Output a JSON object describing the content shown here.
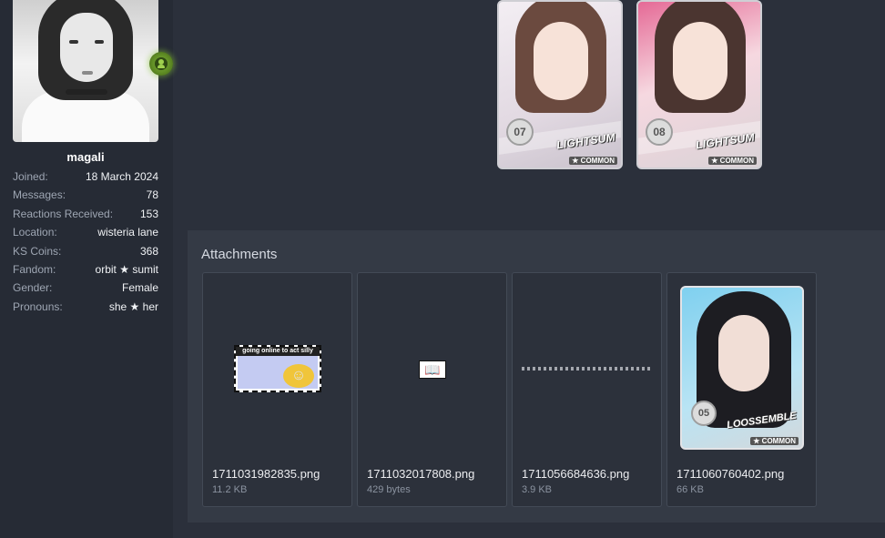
{
  "user": {
    "username": "magali",
    "online_icon": "online-status-icon",
    "stats": [
      {
        "label": "Joined:",
        "value": "18 March 2024"
      },
      {
        "label": "Messages:",
        "value": "78"
      },
      {
        "label": "Reactions Received:",
        "value": "153"
      },
      {
        "label": "Location:",
        "value": "wisteria lane"
      },
      {
        "label": "KS Coins:",
        "value": "368"
      },
      {
        "label": "Fandom:",
        "value": "orbit ★ sumit"
      },
      {
        "label": "Gender:",
        "value": "Female"
      },
      {
        "label": "Pronouns:",
        "value": "she ★ her"
      }
    ]
  },
  "post_cards": [
    {
      "number": "07",
      "group": "LIGHTSUM",
      "rarity": "★ COMMON"
    },
    {
      "number": "08",
      "group": "LIGHTSUM",
      "rarity": "★ COMMON"
    }
  ],
  "attachments": {
    "title": "Attachments",
    "items": [
      {
        "name": "1711031982835.png",
        "size": "11.2 KB",
        "thumb_text": "going online to act silly"
      },
      {
        "name": "1711032017808.png",
        "size": "429 bytes"
      },
      {
        "name": "1711056684636.png",
        "size": "3.9 KB"
      },
      {
        "name": "1711060760402.png",
        "size": "66 KB",
        "card": {
          "number": "05",
          "group": "LOOSSEMBLE",
          "rarity": "★ COMMON"
        }
      }
    ]
  },
  "colors": {
    "page_bg": "#2b303b",
    "panel_bg": "#262b35",
    "attachments_bg": "#343a45",
    "online_accent": "#7fb23a"
  }
}
